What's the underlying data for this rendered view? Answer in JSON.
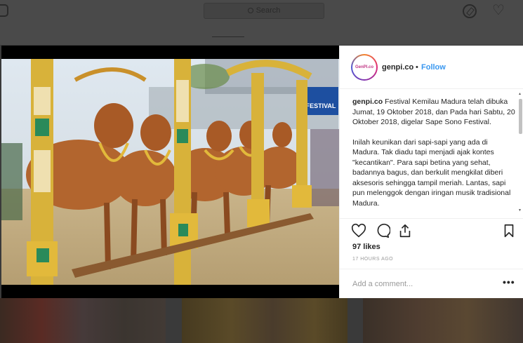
{
  "topbar": {
    "search_placeholder": "Search",
    "icons": [
      "instagram-icon",
      "search-icon",
      "compass-icon",
      "heart-icon"
    ]
  },
  "post": {
    "username": "genpi.co",
    "avatar_text": "GenPI.co",
    "separator": "•",
    "follow_label": "Follow",
    "caption_user": "genpi.co",
    "caption_p1": "Festival Kemilau Madura telah dibuka Jumat, 19 Oktober 2018, dan Pada hari Sabtu, 20 Oktober 2018, digelar Sape Sono Festival.",
    "caption_p2": "Inilah keunikan dari sapi-sapi yang ada di Madura. Tak diadu tapi menjadi ajak kontes \"kecantikan\". Para sapi betina yang sehat, badannya bagus, dan berkulit mengkilat diberi aksesoris sehingga tampil meriah. Lantas, sapi pun melenggok dengan iringan musik tradisional Madura.",
    "likes": "97 likes",
    "time_ago": "17 HOURS AGO",
    "comment_placeholder": "Add a comment...",
    "more_label": "•••",
    "photo_banner": "FESTIVAL"
  },
  "colors": {
    "link": "#3897f0",
    "text": "#262626",
    "muted": "#999999",
    "overlay": "#3a3a3a"
  }
}
